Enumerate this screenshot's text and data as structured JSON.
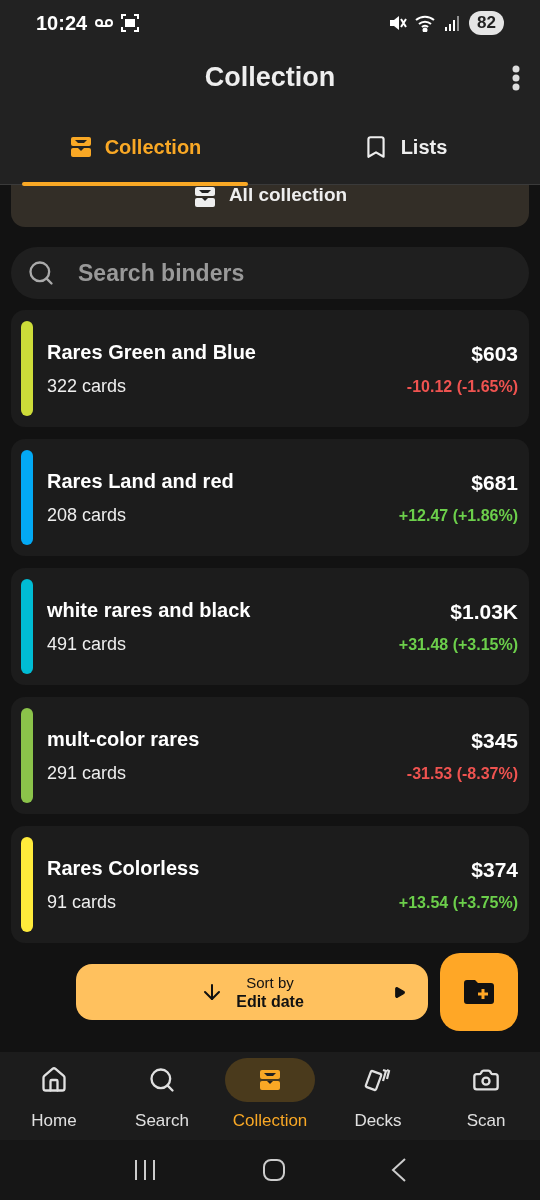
{
  "status_bar": {
    "time": "10:24",
    "battery": "82"
  },
  "app_bar": {
    "title": "Collection"
  },
  "tabs": [
    {
      "label": "Collection",
      "kind": "drawer",
      "selected": true
    },
    {
      "label": "Lists",
      "kind": "book",
      "selected": false
    }
  ],
  "all_collection": {
    "label": "All collection"
  },
  "search": {
    "placeholder": "Search binders"
  },
  "binders": [
    {
      "name": "Rares Green and Blue",
      "count": "322 cards",
      "value": "$603",
      "change": "-10.12 (-1.65%)",
      "kind": "loss",
      "color": "#cddc39"
    },
    {
      "name": "Rares Land and red",
      "count": "208 cards",
      "value": "$681",
      "change": "+12.47 (+1.86%)",
      "kind": "gain",
      "color": "#03a9f4"
    },
    {
      "name": "white rares and black",
      "count": "491 cards",
      "value": "$1.03K",
      "change": "+31.48 (+3.15%)",
      "kind": "gain",
      "color": "#00bcd4"
    },
    {
      "name": "mult-color rares",
      "count": "291 cards",
      "value": "$345",
      "change": "-31.53 (-8.37%)",
      "kind": "loss",
      "color": "#8bc34a"
    },
    {
      "name": "Rares Colorless",
      "count": "91 cards",
      "value": "$374",
      "change": "+13.54 (+3.75%)",
      "kind": "gain",
      "color": "#ffeb3b"
    }
  ],
  "sort": {
    "label": "Sort by",
    "value": "Edit date"
  },
  "bottom_nav": [
    {
      "label": "Home",
      "kind": "home",
      "selected": false
    },
    {
      "label": "Search",
      "kind": "search",
      "selected": false
    },
    {
      "label": "Collection",
      "kind": "drawer",
      "selected": true
    },
    {
      "label": "Decks",
      "kind": "cards",
      "selected": false
    },
    {
      "label": "Scan",
      "kind": "camera",
      "selected": false
    }
  ]
}
